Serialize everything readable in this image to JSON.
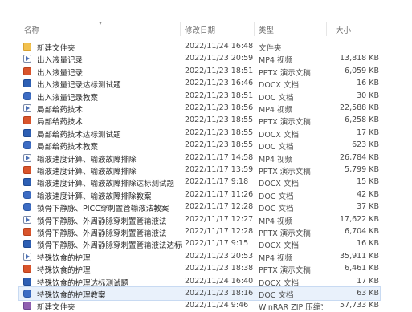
{
  "columns": {
    "name": "名称",
    "date": "修改日期",
    "type": "类型",
    "size": "大小"
  },
  "files": [
    {
      "icon": "folder-icon",
      "kind": "folder",
      "name": "新建文件夹",
      "date": "2022/11/24 16:48",
      "type": "文件夹",
      "size": ""
    },
    {
      "icon": "video-file-icon",
      "kind": "mp4",
      "name": "出入液量记录",
      "date": "2022/11/23 20:59",
      "type": "MP4 视频",
      "size": "13,818 KB"
    },
    {
      "icon": "ppt-file-icon",
      "kind": "pptx",
      "name": "出入液量记录",
      "date": "2022/11/23 18:51",
      "type": "PPTX 演示文稿",
      "size": "6,059 KB"
    },
    {
      "icon": "word-file-icon",
      "kind": "docx",
      "name": "出入液量记录达标测试题",
      "date": "2022/11/23 16:46",
      "type": "DOCX 文档",
      "size": "16 KB"
    },
    {
      "icon": "doc-file-icon",
      "kind": "doc",
      "name": "出入液量记录教案",
      "date": "2022/11/23 18:51",
      "type": "DOC 文档",
      "size": "30 KB"
    },
    {
      "icon": "video-file-icon",
      "kind": "mp4",
      "name": "局部给药技术",
      "date": "2022/11/23 18:56",
      "type": "MP4 视频",
      "size": "22,588 KB"
    },
    {
      "icon": "ppt-file-icon",
      "kind": "pptx",
      "name": "局部给药技术",
      "date": "2022/11/23 18:55",
      "type": "PPTX 演示文稿",
      "size": "6,258 KB"
    },
    {
      "icon": "word-file-icon",
      "kind": "docx",
      "name": "局部给药技术达标测试题",
      "date": "2022/11/23 18:55",
      "type": "DOCX 文档",
      "size": "17 KB"
    },
    {
      "icon": "doc-file-icon",
      "kind": "doc",
      "name": "局部给药技术教案",
      "date": "2022/11/23 18:55",
      "type": "DOC 文档",
      "size": "623 KB"
    },
    {
      "icon": "video-file-icon",
      "kind": "mp4",
      "name": "输液速度计算、输液故障排除",
      "date": "2022/11/17 14:58",
      "type": "MP4 视频",
      "size": "26,784 KB"
    },
    {
      "icon": "ppt-file-icon",
      "kind": "pptx",
      "name": "输液速度计算、输液故障排除",
      "date": "2022/11/17 13:59",
      "type": "PPTX 演示文稿",
      "size": "5,799 KB"
    },
    {
      "icon": "word-file-icon",
      "kind": "docx",
      "name": "输液速度计算、输液故障排除达标测试题",
      "date": "2022/11/17 9:18",
      "type": "DOCX 文档",
      "size": "15 KB"
    },
    {
      "icon": "doc-file-icon",
      "kind": "doc",
      "name": "输液速度计算、输液故障排除教案",
      "date": "2022/11/17 11:26",
      "type": "DOC 文档",
      "size": "42 KB"
    },
    {
      "icon": "doc-file-icon",
      "kind": "doc",
      "name": "锁骨下静脉、PICC穿刺置管输液法教案",
      "date": "2022/11/17 12:28",
      "type": "DOC 文档",
      "size": "37 KB"
    },
    {
      "icon": "video-file-icon",
      "kind": "mp4",
      "name": "锁骨下静脉、外周静脉穿刺置管输液法",
      "date": "2022/11/17 12:27",
      "type": "MP4 视频",
      "size": "17,622 KB"
    },
    {
      "icon": "ppt-file-icon",
      "kind": "pptx",
      "name": "锁骨下静脉、外周静脉穿刺置管输液法",
      "date": "2022/11/17 12:28",
      "type": "PPTX 演示文稿",
      "size": "6,704 KB"
    },
    {
      "icon": "word-file-icon",
      "kind": "docx",
      "name": "锁骨下静脉、外周静脉穿刺置管输液法达标测...",
      "date": "2022/11/17 9:15",
      "type": "DOCX 文档",
      "size": "16 KB"
    },
    {
      "icon": "video-file-icon",
      "kind": "mp4",
      "name": "特殊饮食的护理",
      "date": "2022/11/23 20:53",
      "type": "MP4 视频",
      "size": "35,911 KB"
    },
    {
      "icon": "ppt-file-icon",
      "kind": "pptx",
      "name": "特殊饮食的护理",
      "date": "2022/11/23 18:38",
      "type": "PPTX 演示文稿",
      "size": "6,461 KB"
    },
    {
      "icon": "word-file-icon",
      "kind": "docx",
      "name": "特殊饮食的护理达标测试题",
      "date": "2022/11/24 16:40",
      "type": "DOCX 文档",
      "size": "17 KB"
    },
    {
      "icon": "doc-file-icon",
      "kind": "doc",
      "name": "特殊饮食的护理教案",
      "date": "2022/11/23 18:16",
      "type": "DOC 文档",
      "size": "63 KB"
    },
    {
      "icon": "archive-file-icon",
      "kind": "rar",
      "name": "新建文件夹",
      "date": "2022/11/24 9:46",
      "type": "WinRAR ZIP 压缩文件",
      "size": "57,733 KB"
    }
  ],
  "selected_index": 20
}
